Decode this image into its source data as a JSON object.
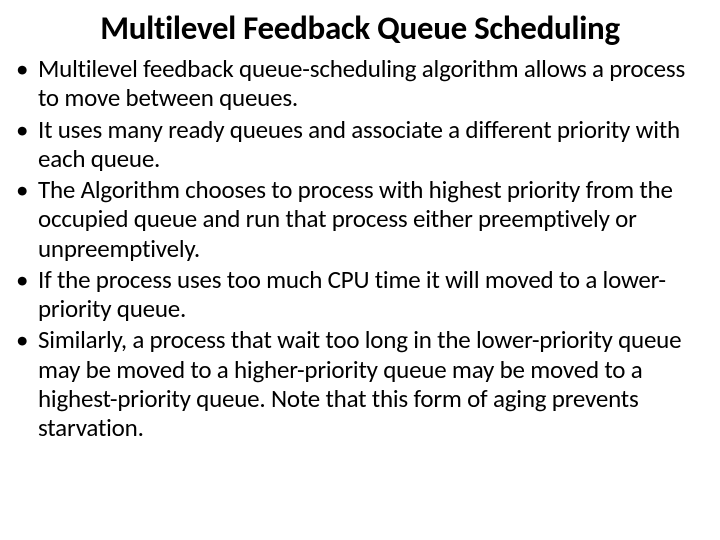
{
  "title": "Multilevel Feedback Queue Scheduling",
  "bullets": [
    "Multilevel feedback queue-scheduling algorithm allows a process to move between queues.",
    "It uses many ready queues and associate a different priority with each queue.",
    "The Algorithm chooses to process with highest priority from the occupied queue and run that process either preemptively or unpreemptively.",
    "If the process uses too much CPU time it will moved to a lower-priority queue.",
    "Similarly, a process that wait too long in the lower-priority queue may be moved to a higher-priority queue may be moved to a highest-priority queue. Note that this form of aging prevents starvation."
  ]
}
